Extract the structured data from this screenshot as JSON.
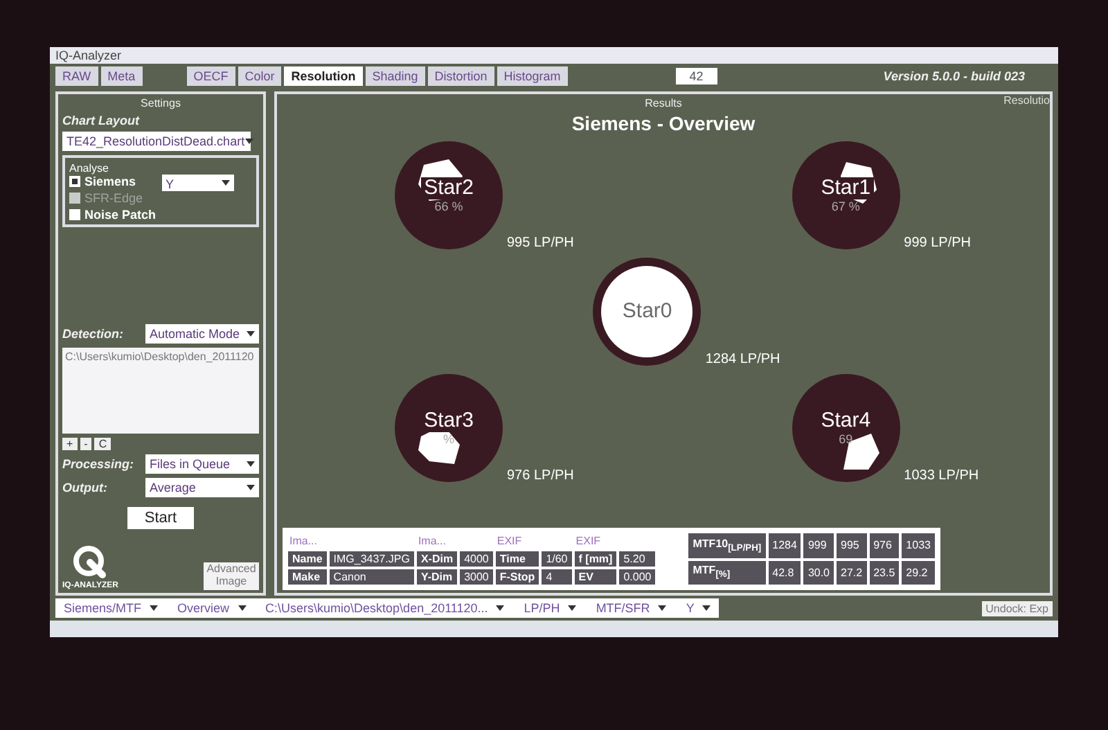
{
  "window": {
    "title": "IQ-Analyzer"
  },
  "tabs": [
    {
      "label": "RAW",
      "selected": false
    },
    {
      "label": "Meta",
      "selected": false
    },
    {
      "label": "OECF",
      "selected": false
    },
    {
      "label": "Color",
      "selected": false
    },
    {
      "label": "Resolution",
      "selected": true
    },
    {
      "label": "Shading",
      "selected": false
    },
    {
      "label": "Distortion",
      "selected": false
    },
    {
      "label": "Histogram",
      "selected": false
    }
  ],
  "image_number": "42",
  "version": "Version 5.0.0 - build 023",
  "settings": {
    "title": "Settings",
    "chart_layout_label": "Chart Layout",
    "chart_layout": "TE42_ResolutionDistDead.chart",
    "analyse": {
      "title": "Analyse",
      "channel": "Y",
      "options": [
        {
          "label": "Siemens",
          "checked": true,
          "disabled": false
        },
        {
          "label": "SFR-Edge",
          "checked": false,
          "disabled": true
        },
        {
          "label": "Noise Patch",
          "checked": false,
          "disabled": false
        }
      ]
    },
    "detection_label": "Detection:",
    "detection": "Automatic Mode",
    "files": [
      "C:\\Users\\kumio\\Desktop\\den_2011120"
    ],
    "file_buttons": [
      "+",
      "-",
      "C"
    ],
    "processing_label": "Processing:",
    "processing": "Files in Queue",
    "output_label": "Output:",
    "output": "Average",
    "start": "Start",
    "logo": "IQ-ANALYZER",
    "advanced": "Advanced Image"
  },
  "results": {
    "title": "Results",
    "side_tab": "Resolutio",
    "heading": "Siemens - Overview",
    "stars": [
      {
        "name": "Star2",
        "percent": "66 %",
        "reading": "995 LP/PH"
      },
      {
        "name": "Star1",
        "percent": "67 %",
        "reading": "999 LP/PH"
      },
      {
        "name": "Star0",
        "reading": "1284 LP/PH"
      },
      {
        "name": "Star3",
        "percent": "%",
        "reading": "976 LP/PH"
      },
      {
        "name": "Star4",
        "percent": "69",
        "reading": "1033 LP/PH"
      }
    ],
    "info_table": {
      "headers": [
        "Ima...",
        "Ima...",
        "EXIF",
        "EXIF"
      ],
      "rows": [
        [
          "Name",
          "IMG_3437.JPG",
          "X-Dim",
          "4000",
          "Time",
          "1/60",
          "f [mm]",
          "5.20"
        ],
        [
          "Make",
          "Canon",
          "Y-Dim",
          "3000",
          "F-Stop",
          "4",
          "EV",
          "0.000"
        ]
      ]
    },
    "mtf_table": {
      "rows": [
        [
          "MTF10$_{[LP/PH]}$",
          "1284",
          "999",
          "995",
          "976",
          "1033"
        ],
        [
          "MTF$_{[%]}$",
          "42.8",
          "30.0",
          "27.2",
          "23.5",
          "29.2"
        ]
      ]
    }
  },
  "bottom_bar": {
    "selectors": [
      "Siemens/MTF",
      "Overview",
      "C:\\Users\\kumio\\Desktop\\den_2011120...",
      "LP/PH",
      "MTF/SFR",
      "Y"
    ],
    "undock": "Undock: Exp"
  }
}
